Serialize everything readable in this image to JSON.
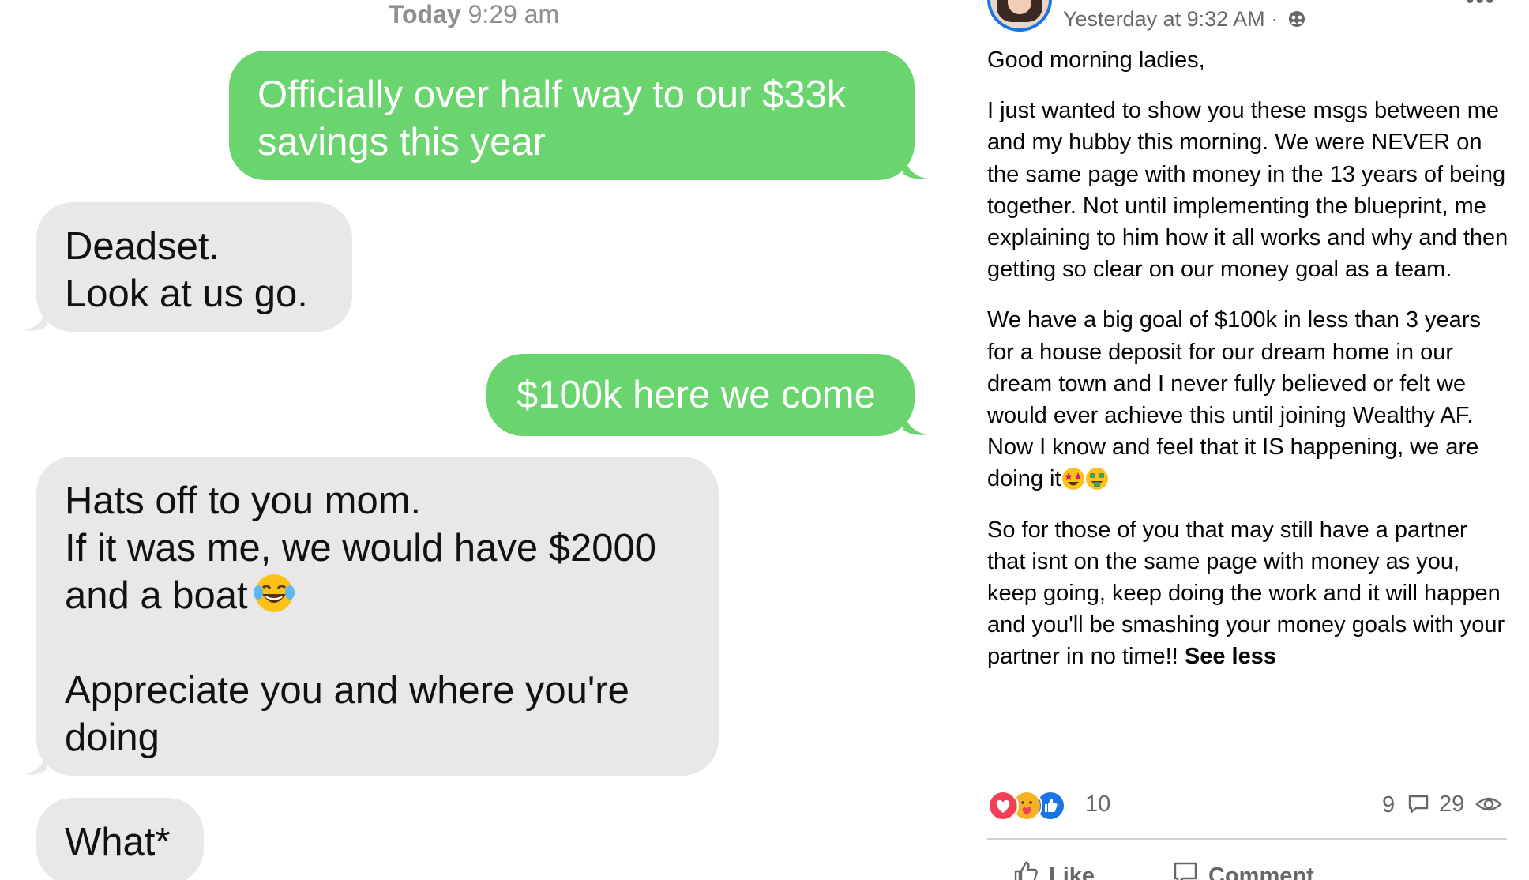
{
  "messages": {
    "timestamp_day": "Today",
    "timestamp_time": "9:29 am",
    "bubbles": [
      {
        "direction": "outgoing",
        "lines": [
          "Officially over half way to our $33k",
          "savings this year"
        ]
      },
      {
        "direction": "incoming",
        "lines": [
          "Deadset.",
          "Look at us go."
        ]
      },
      {
        "direction": "outgoing",
        "lines": [
          "$100k here we come"
        ]
      },
      {
        "direction": "incoming",
        "lines": [
          "Hats off to you mom.",
          "If it was me, we would have $2000",
          "and a boat",
          "",
          "Appreciate you and where you're",
          "doing"
        ],
        "emoji": "laughing-tears-emoji"
      },
      {
        "direction": "incoming",
        "lines": [
          "What*"
        ]
      }
    ],
    "colors": {
      "outgoing": "#6ad46f",
      "incoming": "#e8e8ea",
      "timestamp": "#8e8e93"
    }
  },
  "post": {
    "timestamp": "Yesterday at 9:32 AM",
    "separator": "·",
    "audience_icon": "group-icon",
    "more_icon": "more-dots-icon",
    "greeting": "Good morning ladies,",
    "paragraph1": "I just wanted to show you these msgs between me and my hubby this morning. We were NEVER on the same page with money in the 13 years of being together. Not until implementing the blueprint, me explaining to him how it all works and why and then getting so clear on our money goal as a team.",
    "paragraph2": "We have a big goal of $100k in less than 3 years for a house deposit for our dream home in our dream town and I never fully believed or felt we would ever achieve this until joining Wealthy AF. Now I know and feel that it IS happening, we are doing it",
    "paragraph2_emojis": [
      "star-struck-emoji",
      "money-mouth-emoji"
    ],
    "paragraph3": "So for those of you that may still have a partner that isnt on the same page with money as you, keep going, keep doing the work and it will happen and you'll be smashing your money goals with your partner in no time!!",
    "see_less": "See less",
    "reaction_count": "10",
    "reaction_icons": [
      "love-icon",
      "care-icon",
      "like-icon"
    ],
    "comment_count": "9",
    "view_count": "29",
    "actions": {
      "like": "Like",
      "comment": "Comment"
    },
    "colors": {
      "accent": "#1b74e4",
      "meta": "#65676b",
      "love": "#f33e58",
      "like": "#1b74e4",
      "care": "#f7b125"
    }
  }
}
